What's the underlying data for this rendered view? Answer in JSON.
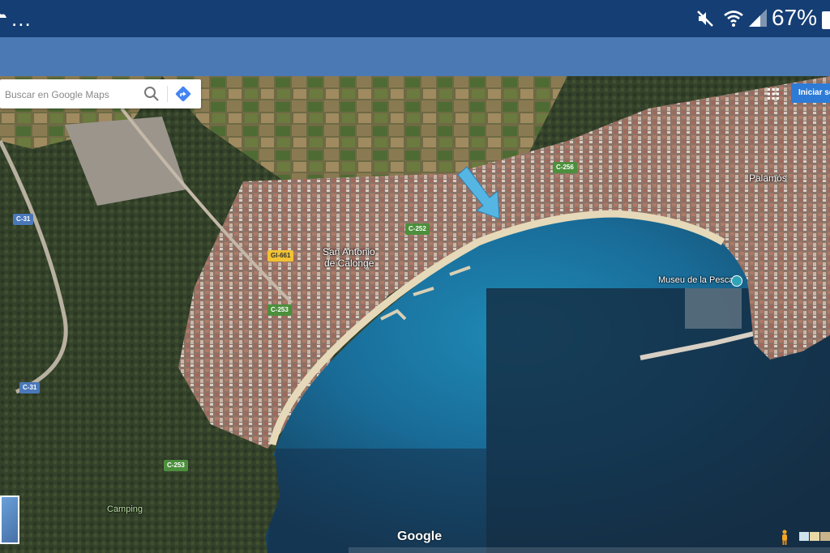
{
  "status_bar": {
    "overflow_dots": "...",
    "battery_percent": "67%",
    "icons": [
      "mute-icon",
      "wifi-icon",
      "signal-icon",
      "battery-icon"
    ],
    "color": "#153e74"
  },
  "app_bar": {
    "color": "#4a79b4"
  },
  "map": {
    "search": {
      "placeholder": "Buscar en Google Maps"
    },
    "sign_in_label": "Iniciar se",
    "places": {
      "town_1": "San Antonio",
      "town_2": "de Calonge",
      "palamos": "Palamós",
      "museum": "Museu de la Pesca",
      "camping": "Camping"
    },
    "roads": {
      "c31_a": "C-31",
      "c31_b": "C-31",
      "gi661": "GI-661",
      "c253_a": "C-253",
      "c253_b": "C-253",
      "c252": "C-252",
      "c256": "C-256"
    },
    "logo": "Google",
    "colors": {
      "sea": "#1a5e8a",
      "land": "#5b6b4a",
      "town": "#8b6b5c",
      "beach": "#e5d9b9"
    }
  }
}
